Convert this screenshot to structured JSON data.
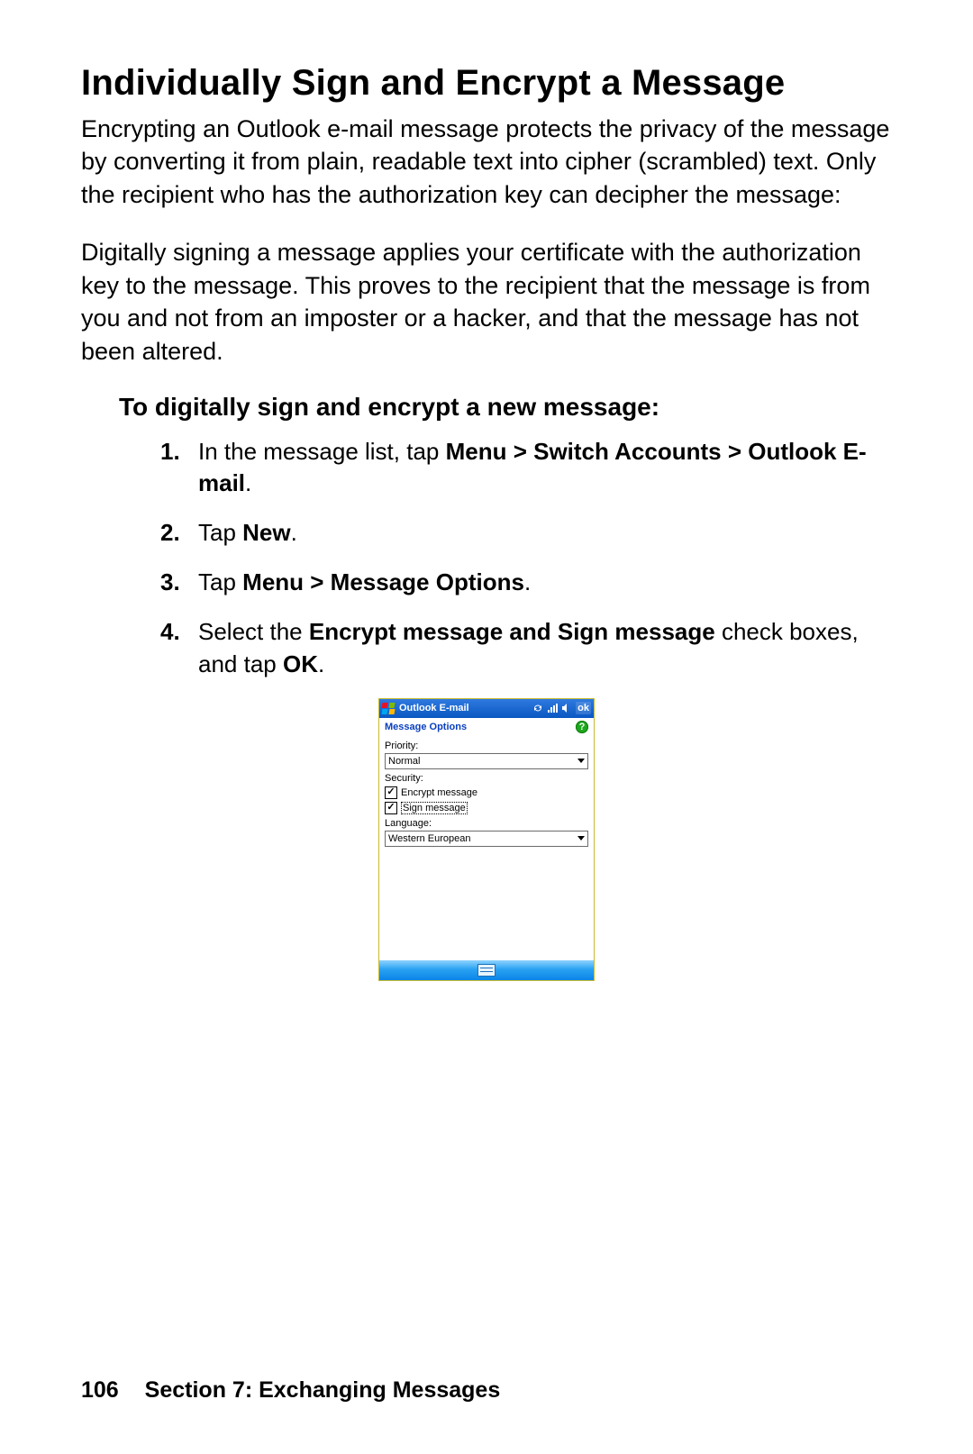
{
  "heading": "Individually Sign and Encrypt a Message",
  "para1": "Encrypting an Outlook e-mail message protects the privacy of the message by converting it from plain, readable text into cipher (scrambled) text. Only the recipient who has the authorization key can decipher the message:",
  "para2": "Digitally signing a message applies your certificate with the authorization key to the message. This proves to the recipient that the message is from you and not from an imposter or a hacker, and that the message has not been altered.",
  "subheading": "To digitally sign and encrypt a new message:",
  "steps": {
    "s1a": "In the message list, tap ",
    "s1b": "Menu > Switch Accounts > Outlook E-mail",
    "s1c": ".",
    "s2a": "Tap ",
    "s2b": "New",
    "s2c": ".",
    "s3a": "Tap ",
    "s3b": "Menu > Message Options",
    "s3c": ".",
    "s4a": "Select the ",
    "s4b": "Encrypt message and Sign message",
    "s4c": " check boxes, and tap ",
    "s4d": "OK",
    "s4e": "."
  },
  "device": {
    "title": "Outlook E-mail",
    "ok": "ok",
    "subheader": "Message Options",
    "help": "?",
    "priority_label": "Priority:",
    "priority_value": "Normal",
    "security_label": "Security:",
    "encrypt": "Encrypt message",
    "sign": "Sign message",
    "language_label": "Language:",
    "language_value": "Western European"
  },
  "footer": {
    "page": "106",
    "section": "Section 7: Exchanging Messages"
  }
}
